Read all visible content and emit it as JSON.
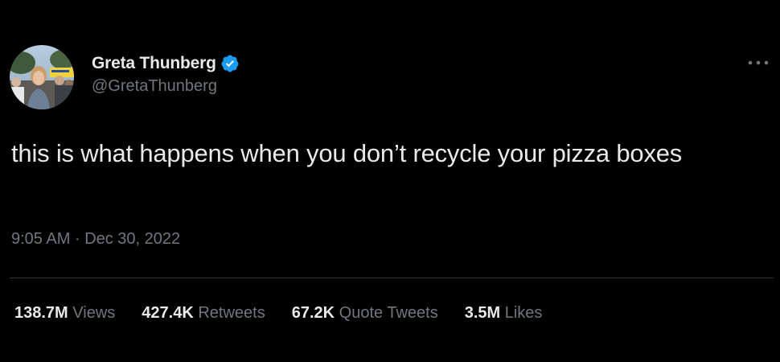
{
  "author": {
    "display_name": "Greta Thunberg",
    "handle": "@GretaThunberg",
    "verified": true,
    "avatar": "profile-photo",
    "verified_icon": "verified-badge-icon",
    "verified_color": "#1d9bf0"
  },
  "more_icon": "more-options-icon",
  "tweet": {
    "text": "this is what happens when you don’t recycle your pizza boxes",
    "time": "9:05 AM",
    "separator": "·",
    "date": "Dec 30, 2022"
  },
  "stats": [
    {
      "value": "138.7M",
      "label": "Views"
    },
    {
      "value": "427.4K",
      "label": "Retweets"
    },
    {
      "value": "67.2K",
      "label": "Quote Tweets"
    },
    {
      "value": "3.5M",
      "label": "Likes"
    }
  ],
  "colors": {
    "background": "#000000",
    "primary_text": "#e7e9ea",
    "secondary_text": "#71767b",
    "divider": "#2f3336"
  }
}
